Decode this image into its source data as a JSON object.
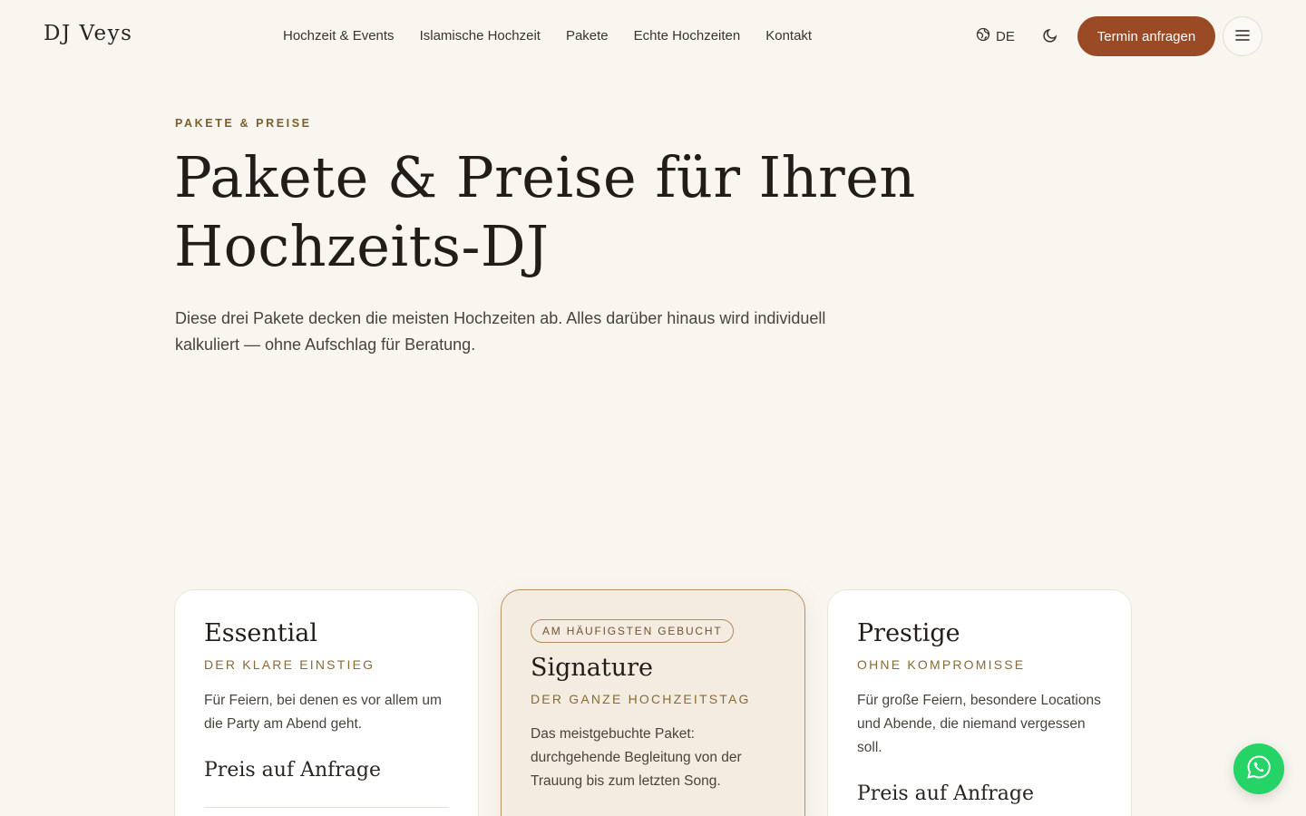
{
  "header": {
    "logo": "DJ Veys",
    "nav": [
      {
        "label": "Hochzeit & Events"
      },
      {
        "label": "Islamische Hochzeit"
      },
      {
        "label": "Pakete"
      },
      {
        "label": "Echte Hochzeiten"
      },
      {
        "label": "Kontakt"
      }
    ],
    "language": "DE",
    "cta": "Termin anfragen"
  },
  "hero": {
    "eyebrow": "PAKETE & PREISE",
    "title_line1": "Pakete & Preise für Ihren",
    "title_line2": "Hochzeits-DJ",
    "subtitle": "Diese drei Pakete decken die meisten Hochzeiten ab. Alles darüber hinaus wird individuell kalkuliert — ohne Aufschlag für Beratung."
  },
  "packages": [
    {
      "name": "Essential",
      "tagline": "DER KLARE EINSTIEG",
      "description": "Für Feiern, bei denen es vor allem um die Party am Abend geht.",
      "price": "Preis auf Anfrage"
    },
    {
      "badge": "AM HÄUFIGSTEN GEBUCHT",
      "name": "Signature",
      "tagline": "DER GANZE HOCHZEITSTAG",
      "description": "Das meistgebuchte Paket: durchgehende Begleitung von der Trauung bis zum letzten Song."
    },
    {
      "name": "Prestige",
      "tagline": "OHNE KOMPROMISSE",
      "description": "Für große Feiern, besondere Locations und Abende, die niemand vergessen soll.",
      "price": "Preis auf Anfrage"
    }
  ],
  "colors": {
    "background": "#f9f6f0",
    "accent": "#9a4a25",
    "gold": "#8a6a35",
    "whatsapp": "#25d366"
  },
  "icons": {
    "language": "globe-icon",
    "theme": "moon-icon",
    "menu": "hamburger-menu-icon",
    "whatsapp": "whatsapp-icon"
  }
}
